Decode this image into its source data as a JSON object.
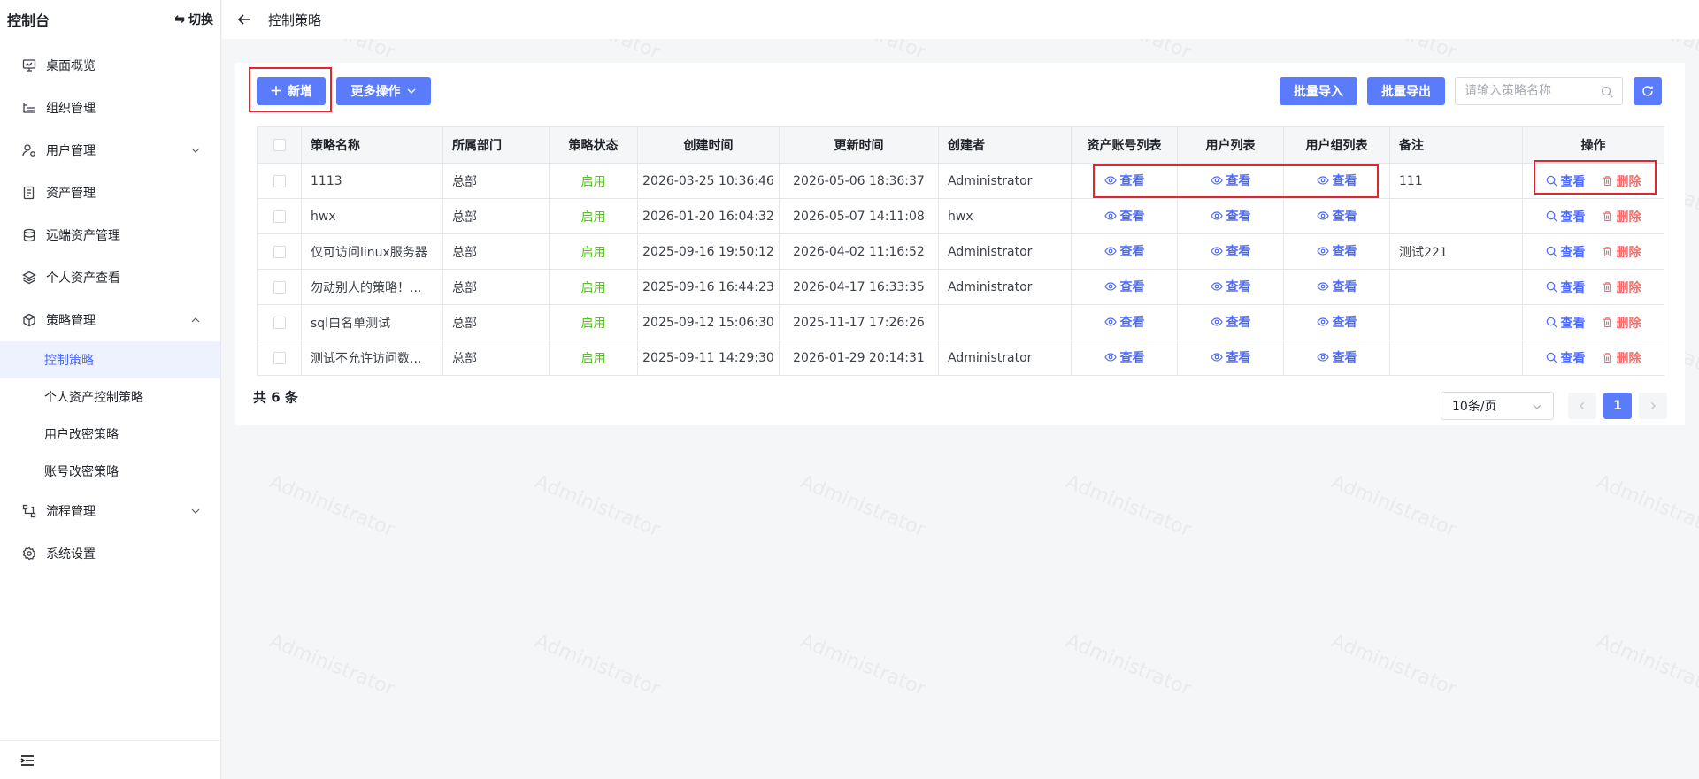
{
  "sidebar": {
    "title": "控制台",
    "switch_label": "切换",
    "items": [
      {
        "label": "桌面概览",
        "icon": "monitor-icon"
      },
      {
        "label": "组织管理",
        "icon": "org-icon"
      },
      {
        "label": "用户管理",
        "icon": "user-gear-icon",
        "expandable": true
      },
      {
        "label": "资产管理",
        "icon": "asset-icon"
      },
      {
        "label": "远端资产管理",
        "icon": "database-icon"
      },
      {
        "label": "个人资产查看",
        "icon": "layers-icon"
      },
      {
        "label": "策略管理",
        "icon": "box-icon",
        "expanded": true
      }
    ],
    "sub_items": [
      {
        "label": "控制策略",
        "active": true
      },
      {
        "label": "个人资产控制策略"
      },
      {
        "label": "用户改密策略"
      },
      {
        "label": "账号改密策略"
      }
    ],
    "items_after": [
      {
        "label": "流程管理",
        "icon": "flow-icon",
        "expandable": true
      },
      {
        "label": "系统设置",
        "icon": "gear-icon"
      }
    ]
  },
  "topbar": {
    "breadcrumb": "控制策略"
  },
  "toolbar": {
    "add_label": "新增",
    "more_label": "更多操作",
    "import_label": "批量导入",
    "export_label": "批量导出",
    "search_placeholder": "请输入策略名称"
  },
  "table": {
    "headers": [
      "策略名称",
      "所属部门",
      "策略状态",
      "创建时间",
      "更新时间",
      "创建者",
      "资产账号列表",
      "用户列表",
      "用户组列表",
      "备注",
      "操作"
    ],
    "view_label": "查看",
    "delete_label": "删除",
    "rows": [
      {
        "name": "1113",
        "dept": "总部",
        "status": "启用",
        "created": "2026-03-25 10:36:46",
        "updated": "2026-05-06 18:36:37",
        "creator": "Administrator",
        "remark": "111"
      },
      {
        "name": "hwx",
        "dept": "总部",
        "status": "启用",
        "created": "2026-01-20 16:04:32",
        "updated": "2026-05-07 14:11:08",
        "creator": "hwx",
        "remark": ""
      },
      {
        "name": "仅可访问linux服务器",
        "dept": "总部",
        "status": "启用",
        "created": "2025-09-16 19:50:12",
        "updated": "2026-04-02 11:16:52",
        "creator": "Administrator",
        "remark": "测试221"
      },
      {
        "name": "勿动别人的策略！...",
        "dept": "总部",
        "status": "启用",
        "created": "2025-09-16 16:44:23",
        "updated": "2026-04-17 16:33:35",
        "creator": "Administrator",
        "remark": ""
      },
      {
        "name": "sql白名单测试",
        "dept": "总部",
        "status": "启用",
        "created": "2025-09-12 15:06:30",
        "updated": "2025-11-17 17:26:26",
        "creator": "",
        "remark": ""
      },
      {
        "name": "测试不允许访问数...",
        "dept": "总部",
        "status": "启用",
        "created": "2025-09-11 14:29:30",
        "updated": "2026-01-29 20:14:31",
        "creator": "Administrator",
        "remark": ""
      }
    ]
  },
  "footer": {
    "total_text": "共 6 条",
    "page_size": "10条/页",
    "current_page": "1"
  },
  "watermark": "Administrator",
  "colors": {
    "primary": "#5b7cfa",
    "link": "#4d6bfe",
    "danger": "#f56c6c",
    "success": "#52c41a",
    "highlight": "#e0262f"
  }
}
